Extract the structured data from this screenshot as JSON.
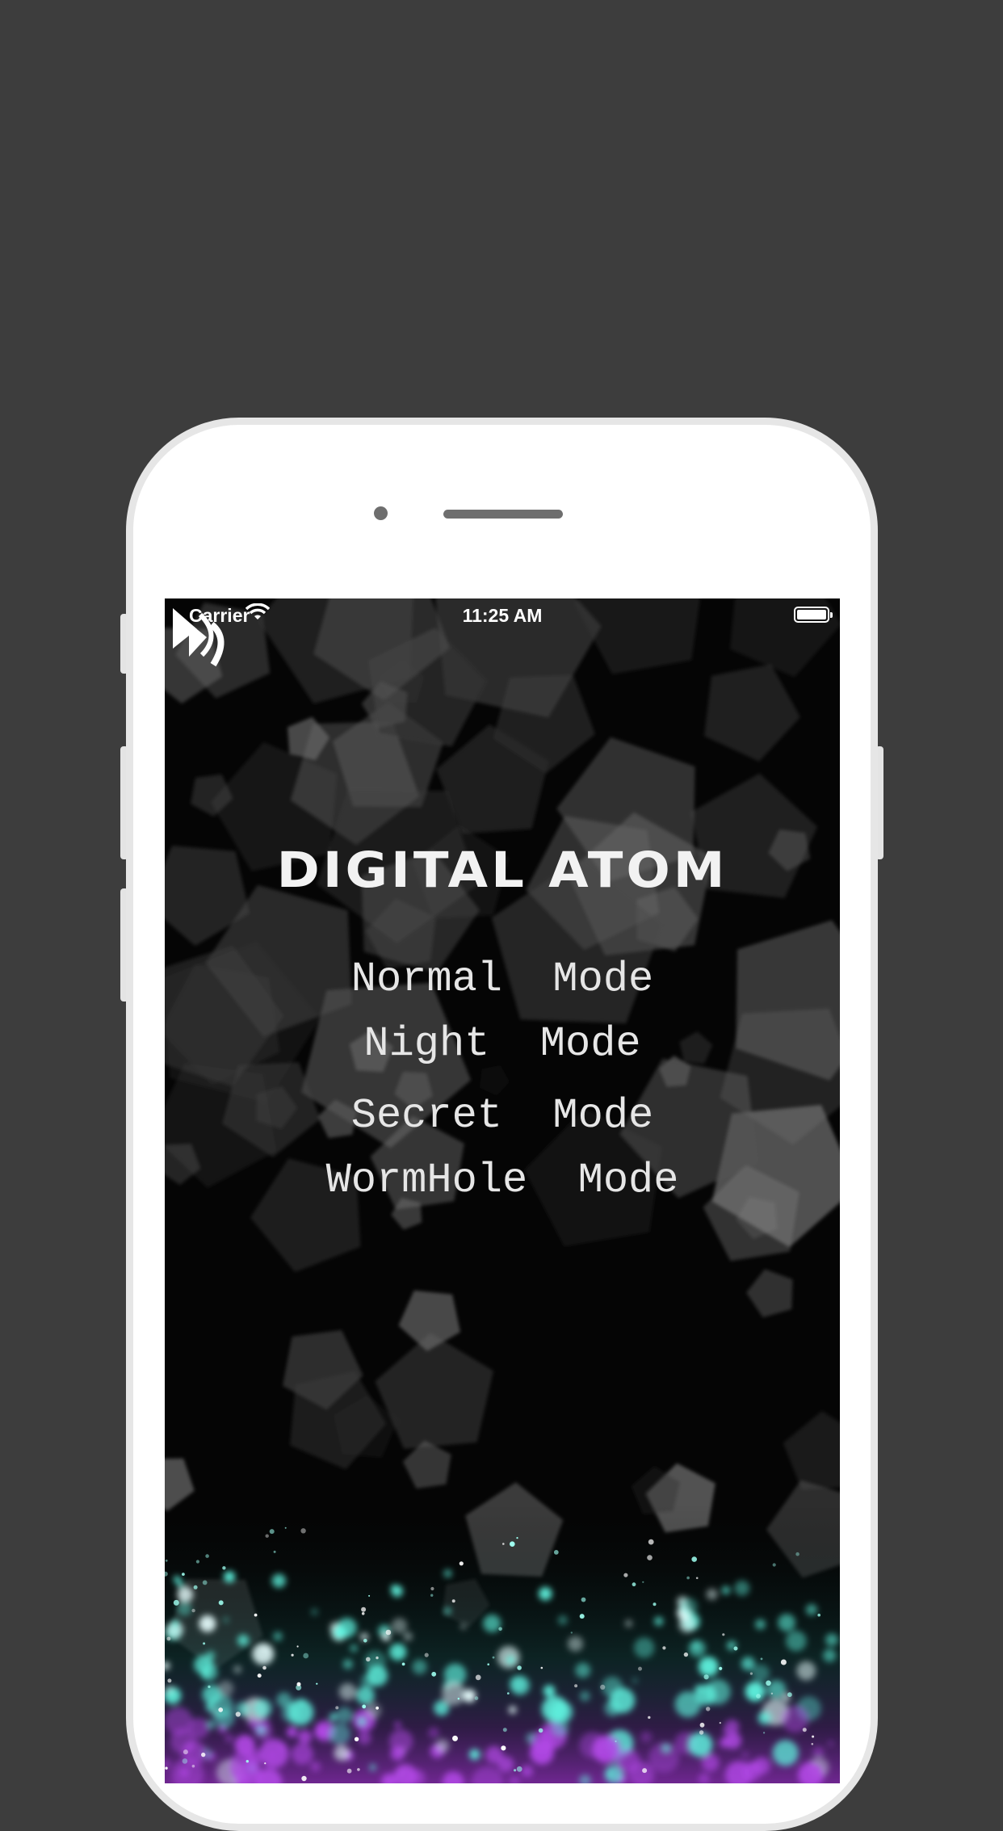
{
  "statusbar": {
    "carrier": "Carrier",
    "time": "11:25 AM"
  },
  "app": {
    "title": "DIGITAL ATOM",
    "modes": [
      {
        "label": "Normal  Mode"
      },
      {
        "label": "Night  Mode"
      },
      {
        "label": "Secret  Mode"
      },
      {
        "label": "WormHole  Mode"
      }
    ]
  },
  "colors": {
    "background": "#3d3d3d",
    "screen": "#050505",
    "particles_cyan": "#5ff4e0",
    "particles_purple": "#b248e6"
  }
}
